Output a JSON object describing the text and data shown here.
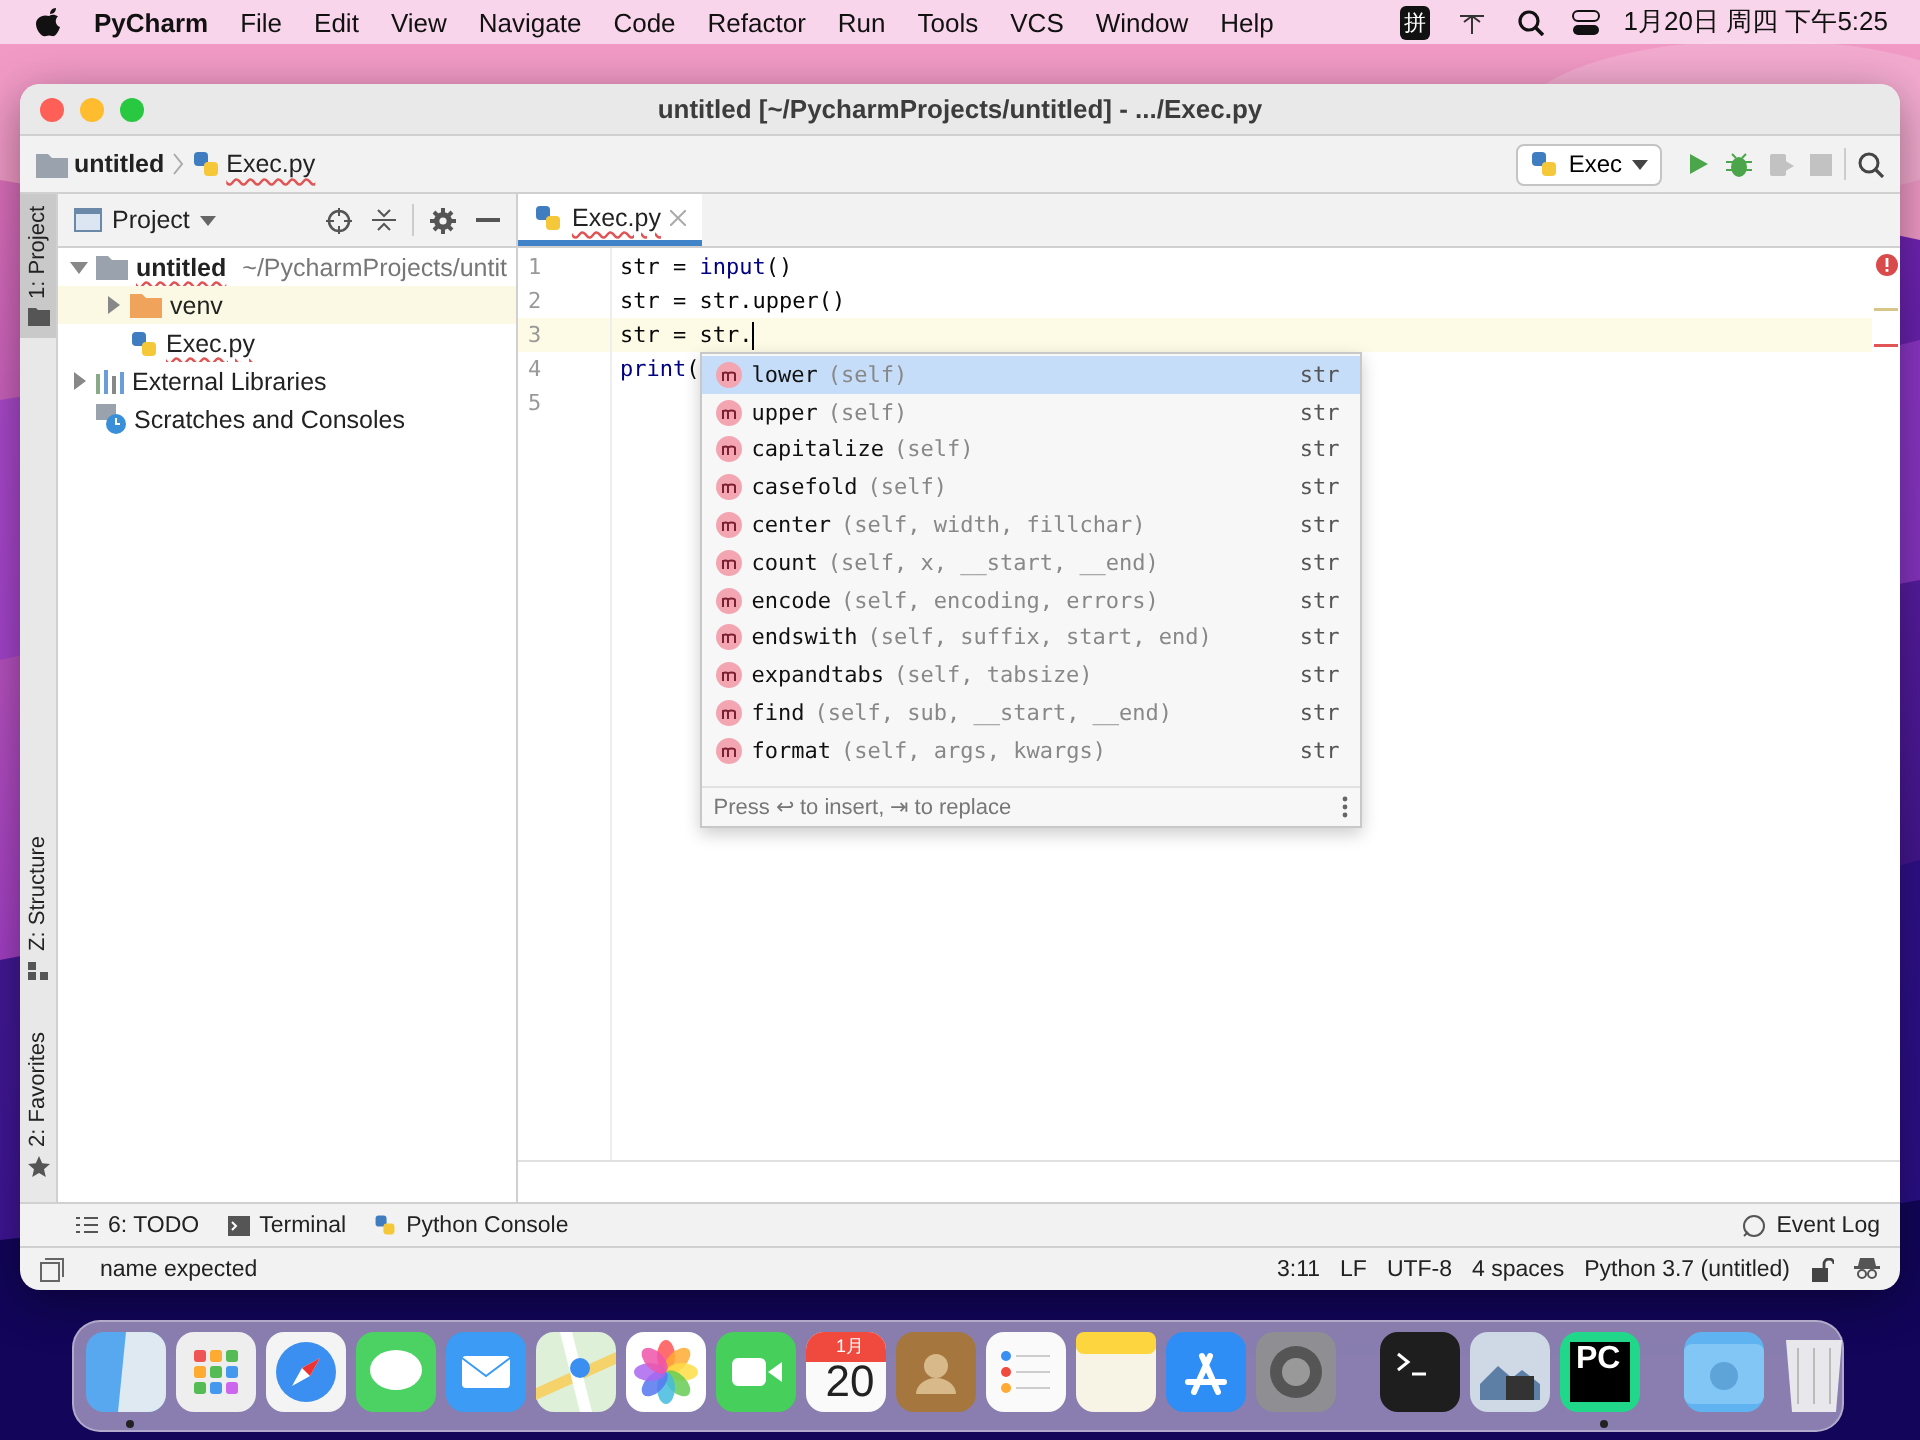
{
  "menu_bar": {
    "app": "PyCharm",
    "menus": [
      "File",
      "Edit",
      "View",
      "Navigate",
      "Code",
      "Refactor",
      "Run",
      "Tools",
      "VCS",
      "Window",
      "Help"
    ],
    "input_method": "拼",
    "clock": "1月20日 周四 下午5:25"
  },
  "window": {
    "title": "untitled [~/PycharmProjects/untitled] - .../Exec.py"
  },
  "nav_bar": {
    "crumbs": [
      {
        "label": "untitled",
        "kind": "folder",
        "error": false
      },
      {
        "label": "Exec.py",
        "kind": "python-file",
        "error": true
      }
    ],
    "run_config": "Exec",
    "actions": [
      {
        "kind": "run",
        "disabled": false
      },
      {
        "kind": "debug",
        "disabled": false
      },
      {
        "kind": "coverage",
        "disabled": true
      },
      {
        "kind": "stop",
        "disabled": true
      }
    ]
  },
  "left_tool_strip": {
    "top": [
      {
        "label": "1: Project",
        "kind": "project",
        "selected": true
      }
    ],
    "bottom": [
      {
        "label": "Z: Structure",
        "kind": "structure",
        "selected": false
      },
      {
        "label": "2: Favorites",
        "kind": "favorites",
        "selected": false
      }
    ]
  },
  "project_panel": {
    "title": "Project",
    "tree": [
      {
        "label": "untitled",
        "path": "~/PycharmProjects/untit",
        "kind": "folder",
        "expanded": true,
        "selected": false,
        "error": true,
        "children": [
          {
            "label": "venv",
            "kind": "excluded-folder",
            "expanded": false,
            "selected": true,
            "error": false
          },
          {
            "label": "Exec.py",
            "kind": "python-file",
            "selected": false,
            "error": true
          }
        ]
      },
      {
        "label": "External Libraries",
        "kind": "libraries",
        "expanded": false,
        "selected": false,
        "error": false
      },
      {
        "label": "Scratches and Consoles",
        "kind": "scratches",
        "selected": false,
        "error": false
      }
    ]
  },
  "editor": {
    "tabs": [
      {
        "label": "Exec.py",
        "selected": true,
        "error": true
      }
    ],
    "lines": [
      {
        "number": "1",
        "current": false,
        "caret": false,
        "tokens": [
          {
            "text": "str = ",
            "kind": "plain"
          },
          {
            "text": "input",
            "kind": "builtin"
          },
          {
            "text": "()",
            "kind": "plain"
          }
        ]
      },
      {
        "number": "2",
        "current": false,
        "caret": false,
        "tokens": [
          {
            "text": "str = str.upper()",
            "kind": "plain"
          }
        ]
      },
      {
        "number": "3",
        "current": true,
        "caret": true,
        "tokens": [
          {
            "text": "str = str.",
            "kind": "plain"
          }
        ]
      },
      {
        "number": "4",
        "current": false,
        "caret": false,
        "tokens": [
          {
            "text": "print",
            "kind": "builtin"
          },
          {
            "text": "(",
            "kind": "plain"
          }
        ]
      },
      {
        "number": "5",
        "current": false,
        "caret": false
      }
    ],
    "completion": {
      "items": [
        {
          "name": "lower",
          "params": "(self)",
          "type": "str",
          "selected": true
        },
        {
          "name": "upper",
          "params": "(self)",
          "type": "str",
          "selected": false
        },
        {
          "name": "capitalize",
          "params": "(self)",
          "type": "str",
          "selected": false
        },
        {
          "name": "casefold",
          "params": "(self)",
          "type": "str",
          "selected": false
        },
        {
          "name": "center",
          "params": "(self, width, fillchar)",
          "type": "str",
          "selected": false
        },
        {
          "name": "count",
          "params": "(self, x, __start, __end)",
          "type": "str",
          "selected": false
        },
        {
          "name": "encode",
          "params": "(self, encoding, errors)",
          "type": "str",
          "selected": false
        },
        {
          "name": "endswith",
          "params": "(self, suffix, start, end)",
          "type": "str",
          "selected": false
        },
        {
          "name": "expandtabs",
          "params": "(self, tabsize)",
          "type": "str",
          "selected": false
        },
        {
          "name": "find",
          "params": "(self, sub, __start, __end)",
          "type": "str",
          "selected": false
        },
        {
          "name": "format",
          "params": "(self, args, kwargs)",
          "type": "str",
          "selected": false
        }
      ],
      "hint": "Press ↩ to insert, ⇥ to replace"
    }
  },
  "bottom_tools": {
    "left": [
      {
        "label": "6: TODO",
        "kind": "todo"
      },
      {
        "label": "Terminal",
        "kind": "terminal"
      },
      {
        "label": "Python Console",
        "kind": "console"
      }
    ],
    "right": [
      {
        "label": "Event Log",
        "kind": "event-log"
      }
    ]
  },
  "status_bar": {
    "message": "name expected",
    "fields": [
      "3:11",
      "LF",
      "UTF-8",
      "4 spaces",
      "Python 3.7 (untitled)"
    ]
  },
  "dock": {
    "groups": [
      [
        {
          "kind": "finder",
          "running": true
        },
        {
          "kind": "launchpad",
          "running": false
        },
        {
          "kind": "compass",
          "running": false
        },
        {
          "kind": "messages",
          "running": false
        },
        {
          "kind": "mail",
          "running": false
        },
        {
          "kind": "maps",
          "running": false
        },
        {
          "kind": "photos",
          "running": false
        },
        {
          "kind": "video",
          "running": false
        },
        {
          "kind": "calendar",
          "month": "1月",
          "day": "20",
          "running": false
        },
        {
          "kind": "contacts",
          "running": false
        },
        {
          "kind": "reminders",
          "running": false
        },
        {
          "kind": "notes",
          "running": false
        },
        {
          "kind": "appstore",
          "running": false
        },
        {
          "kind": "settings",
          "running": false
        }
      ],
      [
        {
          "kind": "terminal",
          "running": false
        },
        {
          "kind": "preview",
          "running": false
        },
        {
          "kind": "pycharm",
          "label": "PC",
          "running": true
        }
      ],
      [
        {
          "kind": "downloads",
          "running": false
        },
        {
          "kind": "trash",
          "running": false
        }
      ]
    ]
  }
}
